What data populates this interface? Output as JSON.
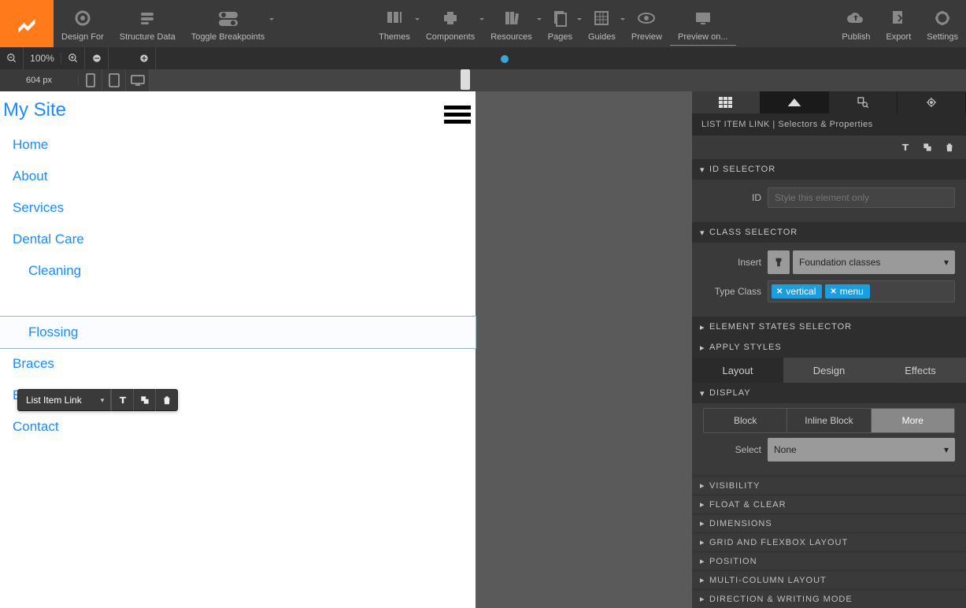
{
  "toolbar": {
    "items_left": [
      {
        "label": "Design For"
      },
      {
        "label": "Structure Data"
      },
      {
        "label": "Toggle Breakpoints"
      }
    ],
    "items_mid": [
      {
        "label": "Themes"
      },
      {
        "label": "Components"
      },
      {
        "label": "Resources"
      },
      {
        "label": "Pages"
      },
      {
        "label": "Guides"
      },
      {
        "label": "Preview"
      },
      {
        "label": "Preview on..."
      }
    ],
    "items_right": [
      {
        "label": "Publish"
      },
      {
        "label": "Export"
      },
      {
        "label": "Settings"
      }
    ]
  },
  "zoom": {
    "value": "100%"
  },
  "width_px": "604 px",
  "site": {
    "title": "My Site",
    "nav": [
      "Home",
      "About",
      "Services",
      "Dental Care"
    ],
    "sub": [
      "Cleaning",
      "Flossing"
    ],
    "nav2": [
      "Braces",
      "Emergency",
      "Contact"
    ]
  },
  "mini_toolbar": {
    "label": "List Item Link"
  },
  "inspector": {
    "crumb": "LIST ITEM LINK | Selectors & Properties",
    "sections": {
      "id_selector": "ID SELECTOR",
      "id_label": "ID",
      "id_placeholder": "Style this element only",
      "class_selector": "CLASS SELECTOR",
      "insert_label": "Insert",
      "foundation": "Foundation classes",
      "type_class_label": "Type Class",
      "chips": [
        "vertical",
        "menu"
      ],
      "element_states": "ELEMENT STATES SELECTOR",
      "apply_styles": "APPLY STYLES",
      "style_tabs": [
        "Layout",
        "Design",
        "Effects"
      ],
      "display": "DISPLAY",
      "display_opts": [
        "Block",
        "Inline Block",
        "More"
      ],
      "select_label": "Select",
      "select_value": "None",
      "accordions": [
        "VISIBILITY",
        "FLOAT & CLEAR",
        "DIMENSIONS",
        "GRID AND FLEXBOX LAYOUT",
        "POSITION",
        "MULTI-COLUMN LAYOUT",
        "DIRECTION & WRITING MODE"
      ]
    }
  }
}
